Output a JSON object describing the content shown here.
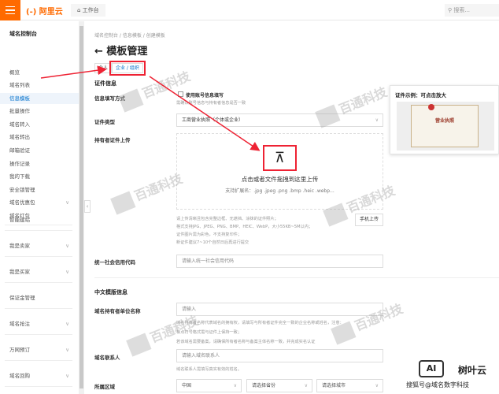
{
  "header": {
    "logo": "(-) 阿里云",
    "workspace": "工作台",
    "search_placeholder": "搜索..."
  },
  "sidebar": {
    "title": "域名控制台",
    "items": [
      {
        "label": "概览"
      },
      {
        "label": "域名列表"
      },
      {
        "label": "信息模板",
        "active": true
      },
      {
        "label": "批量操作"
      },
      {
        "label": "域名转入"
      },
      {
        "label": "域名转出"
      },
      {
        "label": "邮箱验证"
      },
      {
        "label": "操作记录"
      },
      {
        "label": "我的下载"
      },
      {
        "label": "安全锁管理"
      },
      {
        "label": "域名优惠包",
        "chevron": true
      },
      {
        "label": "域名红包"
      }
    ],
    "groups": [
      {
        "label": "智能建站"
      },
      {
        "label": "我是卖家",
        "chevron": true
      },
      {
        "label": "我是买家",
        "chevron": true
      },
      {
        "label": "保证金管理"
      },
      {
        "label": "域名抢注",
        "chevron": true
      },
      {
        "label": "万网预订",
        "chevron": true
      },
      {
        "label": "域名回购",
        "chevron": true
      }
    ]
  },
  "breadcrumb": [
    "域名控制台",
    "信息模板",
    "创建模板"
  ],
  "page": {
    "title": "← 模板管理",
    "tabs": [
      "个人",
      "企业 / 组织"
    ],
    "active_tab": 1
  },
  "cert": {
    "section": "证件信息",
    "fill_label": "信息填写方式",
    "fill_checkbox": "使用账号信息填写",
    "fill_hint": "需确认账号信息与持有者信息是否一致",
    "type_label": "证件类型",
    "type_value": "工商营业执照（个体或企业）",
    "upload_label": "持有者证件上传",
    "upload_text": "点击或者文件拖拽到这里上传",
    "upload_ext": "支持扩展名：.jpg .jpeg .png .bmp .heic .webp...",
    "upload_notes": [
      "请上传清晰且包含完整边框、无遮挡、涂抹的证件照片；",
      "格式支持JPG、JPEG、PNG、BMP、HEIC、WebP，大小55KB~5M以内；",
      "证件图片需为彩色，不支持复印件；",
      "新证件建议7~10个自然日后再进行提交"
    ],
    "mobile_upload": "手机上传",
    "credit_label": "统一社会信用代码",
    "credit_placeholder": "请输入统一社会信用代码"
  },
  "cn": {
    "section": "中文模版信息",
    "owner_label": "域名持有者单位名称",
    "owner_placeholder": "请输入",
    "owner_hints": [
      "域名持有者名称代表域名的拥有权，请填写与所有者证件完全一致的企业名称或姓名，注意：",
      "标点符号格式需与证件上保持一致；",
      "若该域名需要备案，请确保所有者名称与备案主体名称一致，并完成实名认证"
    ],
    "contact_label": "域名联系人",
    "contact_placeholder": "请输入域名联系人",
    "contact_hint": "域名联系人需填写真实有效的姓名。",
    "region_label": "所属区域",
    "country": "中国",
    "province": "请选择省份",
    "city": "请选择城市"
  },
  "popover": {
    "title": "证件示例：可点击放大",
    "cert_title": "营业执照"
  },
  "watermark": "百通科技",
  "overlay": {
    "ai_badge": "AI",
    "brand": "树叶云",
    "source": "搜狐号@域名数字科技"
  },
  "colors": {
    "accent": "#ff6a00",
    "link": "#0070cc",
    "highlight": "#e22233"
  }
}
